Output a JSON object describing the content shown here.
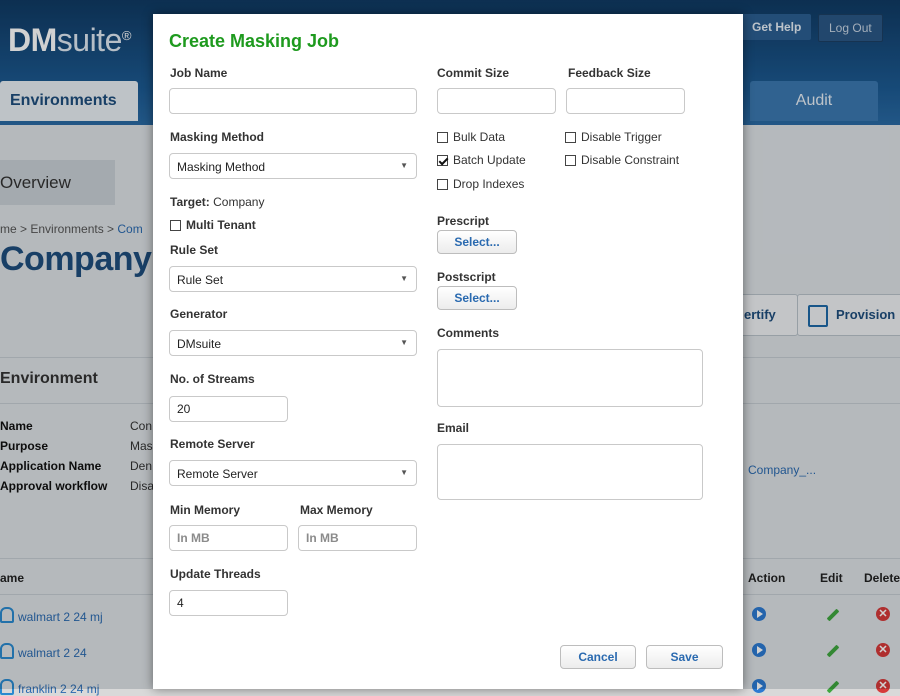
{
  "app": {
    "logo_bold": "DM",
    "logo_rest": "suite",
    "logo_mark": "®",
    "get_help": "Get Help",
    "logout": "Log Out",
    "tab_environments": "Environments",
    "tab_audit": "Audit"
  },
  "page": {
    "overview_tab": "Overview",
    "breadcrumb_prefix": "me > Environments > ",
    "breadcrumb_link": "Com",
    "title": "Company",
    "certify": "ertify",
    "provision": "Provision",
    "section": "Environment",
    "details": [
      {
        "key": "Name",
        "val": "Con"
      },
      {
        "key": "Purpose",
        "val": "Mas"
      },
      {
        "key": "Application Name",
        "val": "Den"
      },
      {
        "key": "Approval workflow",
        "val": "Disa"
      }
    ],
    "app_link": "Company_...",
    "table": {
      "col_name": "ame",
      "col_action": "Action",
      "col_edit": "Edit",
      "col_delete": "Delete",
      "rows": [
        "walmart 2 24 mj",
        "walmart 2 24",
        "franklin 2 24 mj"
      ]
    }
  },
  "modal": {
    "title": "Create Masking Job",
    "job_name_label": "Job Name",
    "job_name_value": "",
    "masking_method_label": "Masking Method",
    "masking_method_value": "Masking Method",
    "target_label": "Target:",
    "target_value": "Company",
    "multi_tenant": "Multi Tenant",
    "rule_set_label": "Rule Set",
    "rule_set_value": "Rule Set",
    "generator_label": "Generator",
    "generator_value": "DMsuite",
    "streams_label": "No. of Streams",
    "streams_value": "20",
    "remote_server_label": "Remote Server",
    "remote_server_value": "Remote Server",
    "min_memory_label": "Min Memory",
    "min_memory_placeholder": "In MB",
    "max_memory_label": "Max Memory",
    "max_memory_placeholder": "In MB",
    "update_threads_label": "Update Threads",
    "update_threads_value": "4",
    "commit_size_label": "Commit Size",
    "feedback_size_label": "Feedback Size",
    "bulk_data": "Bulk Data",
    "disable_trigger": "Disable Trigger",
    "batch_update": "Batch Update",
    "disable_constraint": "Disable Constraint",
    "drop_indexes": "Drop Indexes",
    "prescript_label": "Prescript",
    "prescript_button": "Select...",
    "postscript_label": "Postscript",
    "postscript_button": "Select...",
    "comments_label": "Comments",
    "email_label": "Email",
    "cancel": "Cancel",
    "save": "Save"
  }
}
